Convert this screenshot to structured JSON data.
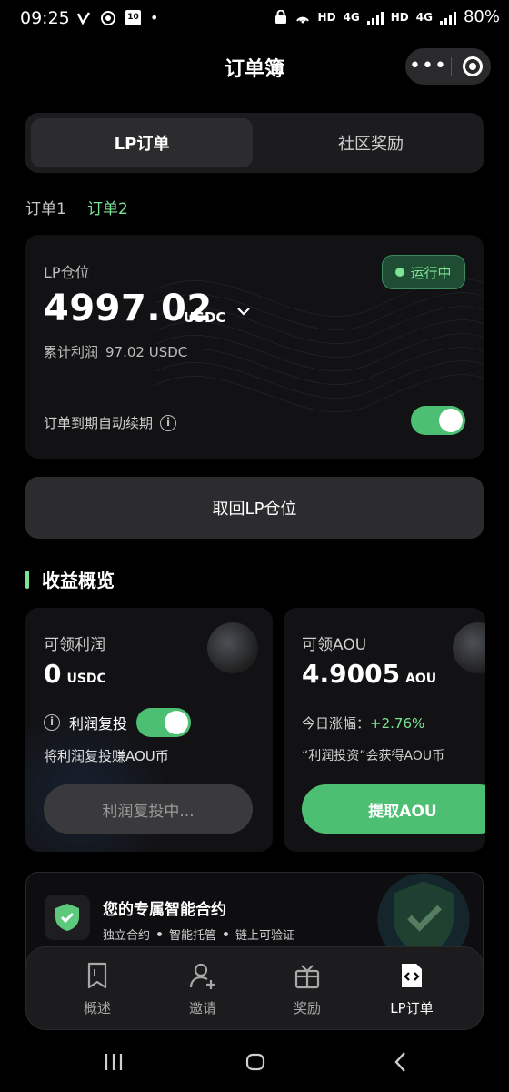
{
  "status_bar": {
    "time": "09:25",
    "left_icons": [
      "v-icon",
      "record-icon",
      "calendar-10-icon"
    ],
    "calendar_day": "10",
    "dot": "•",
    "hd1": "HD",
    "net1": "4G",
    "hd2": "HD",
    "net2": "4G",
    "battery": "80%"
  },
  "header": {
    "title": "订单簿",
    "more": "•••"
  },
  "tabs": {
    "active": "LP订单",
    "inactive": "社区奖励"
  },
  "subtabs": {
    "order1": "订单1",
    "order2": "订单2"
  },
  "lp_card": {
    "label": "LP仓位",
    "amount": "4997.02",
    "unit": "USDC",
    "status": "运行中",
    "profit_label": "累计利润",
    "profit_value": "97.02 USDC",
    "renew_label": "订单到期自动续期",
    "renew_on": true
  },
  "withdraw_button": "取回LP仓位",
  "section": {
    "title": "收益概览"
  },
  "profit_card": {
    "label": "可领利润",
    "amount": "0",
    "unit": "USDC",
    "reinvest_label": "利润复投",
    "reinvest_on": true,
    "desc": "将利润复投赚AOU币",
    "button": "利润复投中..."
  },
  "aou_card": {
    "label": "可领AOU",
    "amount": "4.9005",
    "unit": "AOU",
    "today_label": "今日涨幅：",
    "today_value": "+2.76%",
    "desc": "“利润投资”会获得AOU币",
    "button": "提取AOU"
  },
  "contract": {
    "title": "您的专属智能合约",
    "tags": [
      "独立合约",
      "智能托管",
      "链上可验证"
    ]
  },
  "bottom_nav": [
    {
      "label": "概述",
      "icon": "bookmark-icon"
    },
    {
      "label": "邀请",
      "icon": "add-user-icon"
    },
    {
      "label": "奖励",
      "icon": "gift-icon"
    },
    {
      "label": "LP订单",
      "icon": "code-file-icon",
      "active": true
    }
  ],
  "colors": {
    "accent": "#4cbf73",
    "accent_text": "#7be495",
    "bg": "#000000",
    "card": "#121214"
  }
}
